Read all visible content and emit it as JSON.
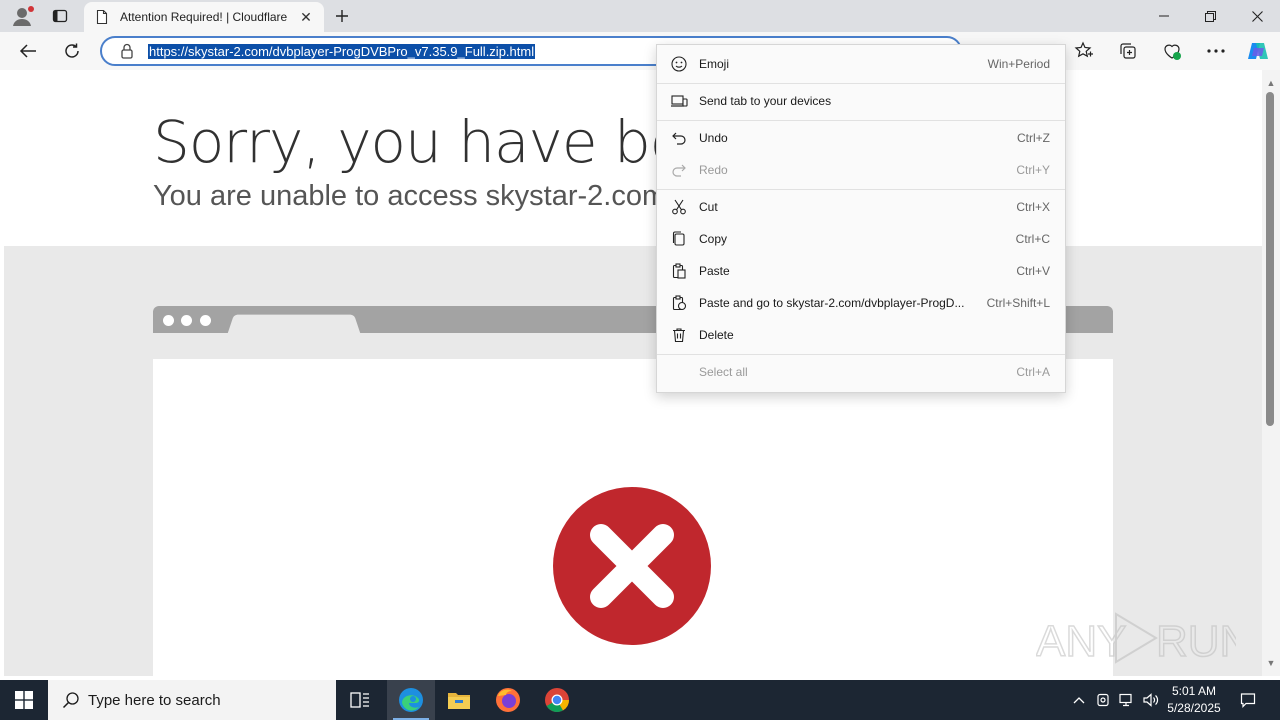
{
  "browser": {
    "tab": {
      "title": "Attention Required! | Cloudflare",
      "close": "✕"
    },
    "new_tab": "+",
    "window_controls": {
      "minimize": "—",
      "restore": "❐",
      "close": "✕"
    },
    "address_bar": {
      "url": "https://skystar-2.com/dvbplayer-ProgDVBPro_v7.35.9_Full.zip.html"
    }
  },
  "page": {
    "heading": "Sorry, you have been blocked",
    "subheading": "You are unable to access skystar-2.com"
  },
  "context_menu": {
    "items": [
      {
        "label": "Emoji",
        "shortcut": "Win+Period",
        "icon": "emoji-icon",
        "enabled": true
      },
      {
        "label": "Send tab to your devices",
        "shortcut": "",
        "icon": "devices-icon",
        "enabled": true
      },
      {
        "label": "Undo",
        "shortcut": "Ctrl+Z",
        "icon": "undo-icon",
        "enabled": true
      },
      {
        "label": "Redo",
        "shortcut": "Ctrl+Y",
        "icon": "redo-icon",
        "enabled": false
      },
      {
        "label": "Cut",
        "shortcut": "Ctrl+X",
        "icon": "scissors-icon",
        "enabled": true
      },
      {
        "label": "Copy",
        "shortcut": "Ctrl+C",
        "icon": "copy-icon",
        "enabled": true
      },
      {
        "label": "Paste",
        "shortcut": "Ctrl+V",
        "icon": "paste-icon",
        "enabled": true
      },
      {
        "label": "Paste and go to skystar-2.com/dvbplayer-ProgD...",
        "shortcut": "Ctrl+Shift+L",
        "icon": "paste-go-icon",
        "enabled": true
      },
      {
        "label": "Delete",
        "shortcut": "",
        "icon": "trash-icon",
        "enabled": true
      },
      {
        "label": "Select all",
        "shortcut": "Ctrl+A",
        "icon": "",
        "enabled": false
      }
    ]
  },
  "taskbar": {
    "search_placeholder": "Type here to search",
    "time": "5:01 AM",
    "date": "5/28/2025"
  },
  "watermark": "ANY RUN",
  "colors": {
    "accent": "#0c4fa8",
    "error_red": "#c0272d",
    "taskbar": "#1c2633"
  }
}
